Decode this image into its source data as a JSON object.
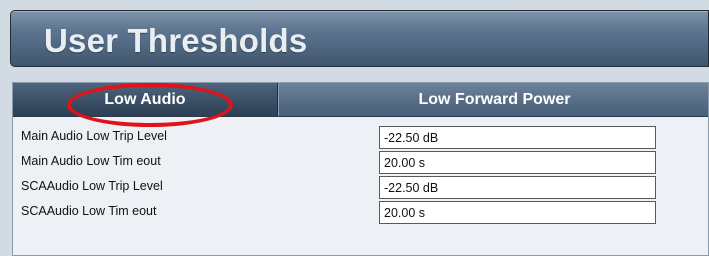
{
  "header": {
    "title": "User Thresholds"
  },
  "tabs": [
    {
      "label": "Low Audio",
      "active": true
    },
    {
      "label": "Low Forward Power",
      "active": false
    }
  ],
  "thresholds": [
    {
      "label": "Main Audio Low Trip Level",
      "value": "-22.50 dB"
    },
    {
      "label": "Main Audio Low Tim eout",
      "value": "20.00 s"
    },
    {
      "label": "SCAAudio Low Trip Level",
      "value": "-22.50 dB"
    },
    {
      "label": "SCAAudio Low Tim eout",
      "value": "20.00 s"
    }
  ],
  "colors": {
    "highlight_ring": "#e0131a",
    "tab_active": "#3a4f65",
    "tab_inactive": "#566d85",
    "title_bar": "#5d7590"
  }
}
